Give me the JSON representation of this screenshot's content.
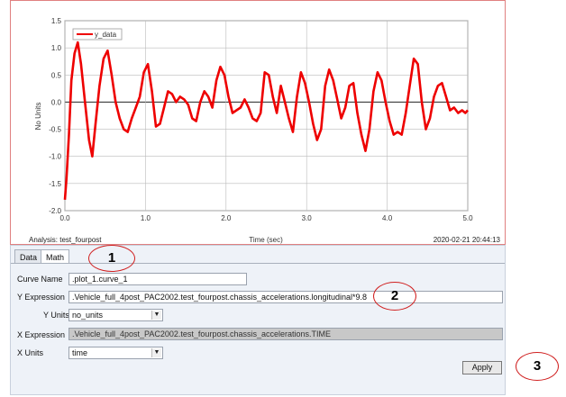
{
  "chart_data": {
    "type": "line",
    "ylabel": "No Units",
    "xlabel": "Time (sec)",
    "xlim": [
      0.0,
      5.0
    ],
    "ylim": [
      -2.0,
      1.5
    ],
    "x_ticks": [
      "0.0",
      "1.0",
      "2.0",
      "3.0",
      "4.0",
      "5.0"
    ],
    "y_ticks": [
      "1.5",
      "1.0",
      "0.5",
      "0.0",
      "-0.5",
      "-1.0",
      "-1.5",
      "-2.0"
    ],
    "grid": true,
    "legend_position": "top-left",
    "series": [
      {
        "name": "y_data",
        "color": "#ee0000",
        "x": [
          0.0,
          0.02,
          0.05,
          0.08,
          0.12,
          0.16,
          0.2,
          0.25,
          0.3,
          0.34,
          0.38,
          0.43,
          0.48,
          0.53,
          0.58,
          0.63,
          0.68,
          0.73,
          0.78,
          0.83,
          0.88,
          0.93,
          0.98,
          1.03,
          1.08,
          1.13,
          1.18,
          1.23,
          1.28,
          1.33,
          1.38,
          1.43,
          1.48,
          1.53,
          1.58,
          1.63,
          1.68,
          1.73,
          1.78,
          1.83,
          1.88,
          1.93,
          1.98,
          2.03,
          2.08,
          2.13,
          2.18,
          2.23,
          2.28,
          2.33,
          2.38,
          2.43,
          2.48,
          2.53,
          2.58,
          2.63,
          2.68,
          2.73,
          2.78,
          2.83,
          2.88,
          2.93,
          2.98,
          3.03,
          3.08,
          3.13,
          3.18,
          3.23,
          3.28,
          3.33,
          3.38,
          3.43,
          3.48,
          3.53,
          3.58,
          3.63,
          3.68,
          3.73,
          3.78,
          3.83,
          3.88,
          3.93,
          3.98,
          4.03,
          4.08,
          4.13,
          4.18,
          4.23,
          4.28,
          4.33,
          4.38,
          4.43,
          4.48,
          4.53,
          4.58,
          4.63,
          4.68,
          4.73,
          4.78,
          4.83,
          4.88,
          4.93,
          4.97,
          5.0
        ],
        "y": [
          -1.8,
          -1.4,
          -0.6,
          0.4,
          0.9,
          1.1,
          0.7,
          0.0,
          -0.7,
          -1.0,
          -0.4,
          0.3,
          0.8,
          0.95,
          0.5,
          0.0,
          -0.3,
          -0.5,
          -0.55,
          -0.3,
          -0.1,
          0.1,
          0.55,
          0.7,
          0.2,
          -0.45,
          -0.4,
          -0.1,
          0.2,
          0.15,
          0.0,
          0.1,
          0.05,
          -0.05,
          -0.3,
          -0.35,
          0.0,
          0.2,
          0.1,
          -0.1,
          0.4,
          0.65,
          0.5,
          0.1,
          -0.2,
          -0.15,
          -0.1,
          0.05,
          -0.1,
          -0.3,
          -0.35,
          -0.2,
          0.55,
          0.5,
          0.1,
          -0.2,
          0.3,
          0.0,
          -0.3,
          -0.55,
          0.1,
          0.55,
          0.35,
          0.0,
          -0.4,
          -0.7,
          -0.5,
          0.3,
          0.6,
          0.4,
          0.05,
          -0.3,
          -0.1,
          0.3,
          0.35,
          -0.2,
          -0.6,
          -0.9,
          -0.5,
          0.2,
          0.55,
          0.4,
          0.0,
          -0.35,
          -0.6,
          -0.55,
          -0.6,
          -0.2,
          0.3,
          0.8,
          0.7,
          0.0,
          -0.5,
          -0.3,
          0.1,
          0.3,
          0.35,
          0.1,
          -0.15,
          -0.1,
          -0.2,
          -0.15,
          -0.2,
          -0.15
        ]
      }
    ]
  },
  "footer": {
    "analysis": "Analysis: test_fourpost",
    "timestamp": "2020-02-21 20:44:13"
  },
  "tabs": [
    {
      "label": "Data"
    },
    {
      "label": "Math"
    }
  ],
  "form": {
    "curve_name_label": "Curve Name",
    "curve_name_value": ".plot_1.curve_1",
    "y_expression_label": "Y Expression",
    "y_expression_value": ".Vehicle_full_4post_PAC2002.test_fourpost.chassis_accelerations.longitudinal*9.8",
    "y_units_label": "Y Units",
    "y_units_value": "no_units",
    "x_expression_label": "X Expression",
    "x_expression_value": ".Vehicle_full_4post_PAC2002.test_fourpost.chassis_accelerations.TIME",
    "x_units_label": "X Units",
    "x_units_value": "time",
    "apply_label": "Apply"
  },
  "annotations": [
    "1",
    "2",
    "3"
  ]
}
